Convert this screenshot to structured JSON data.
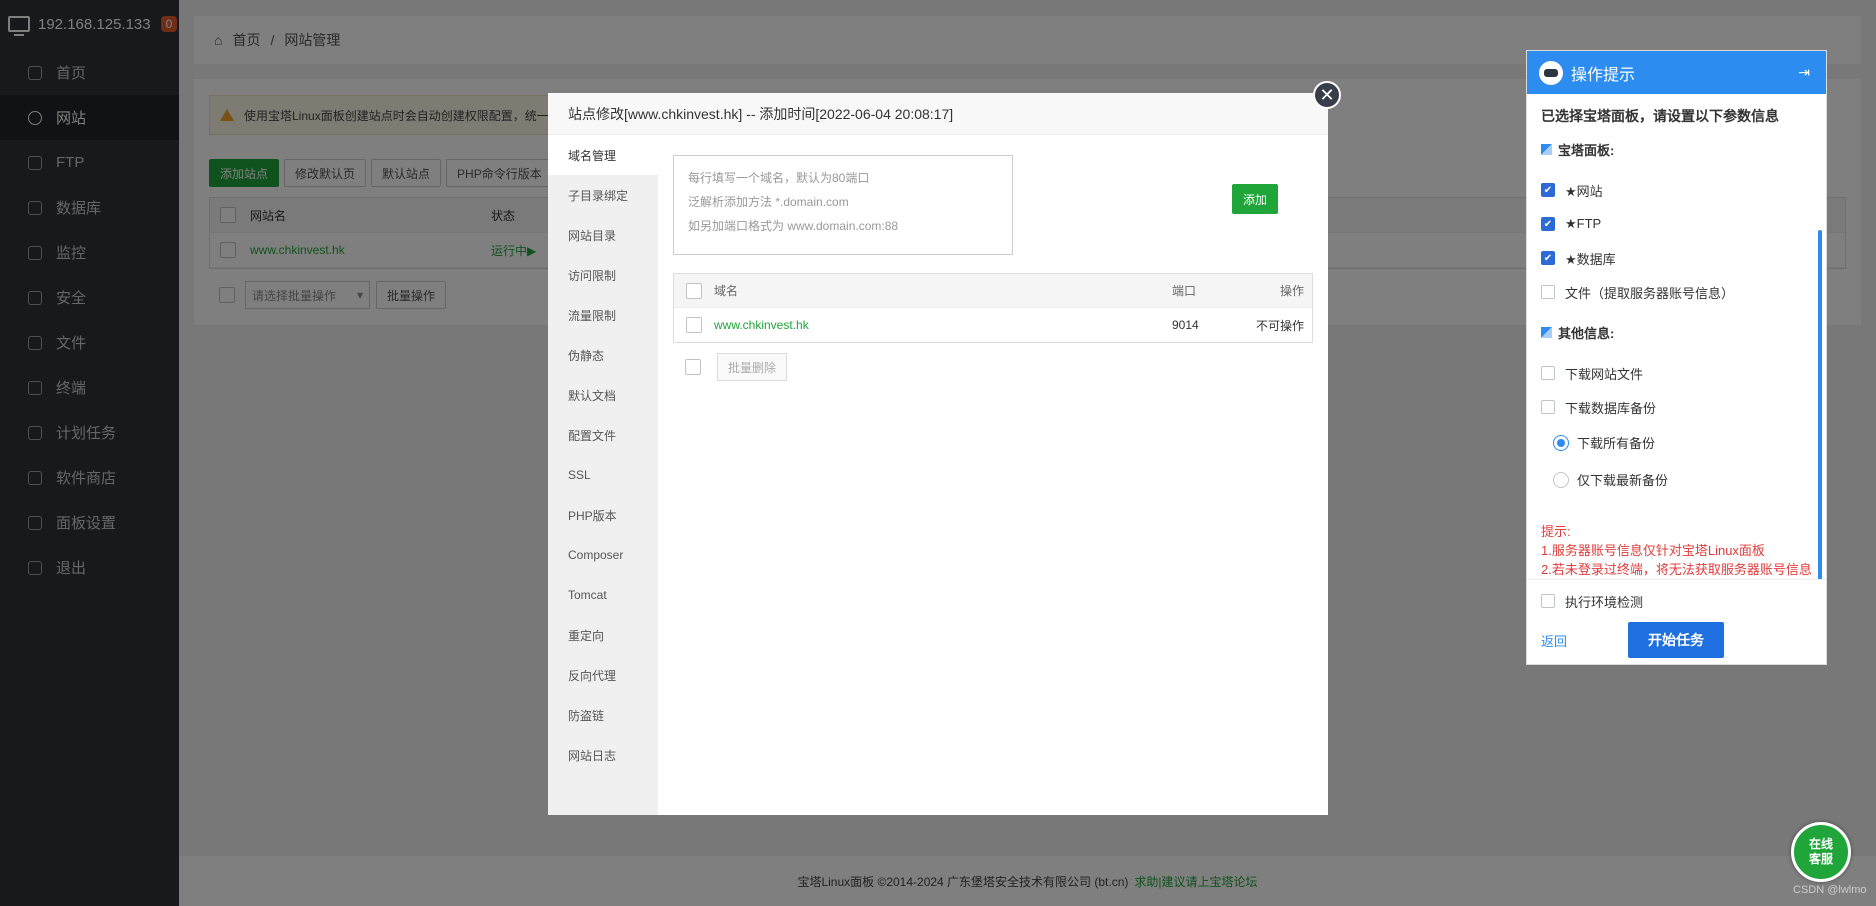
{
  "sidebar": {
    "host": "192.168.125.133",
    "badge": "0",
    "items": [
      {
        "label": "首页",
        "icon": "home-icon"
      },
      {
        "label": "网站",
        "icon": "globe-icon",
        "active": true
      },
      {
        "label": "FTP",
        "icon": "ftp-icon"
      },
      {
        "label": "数据库",
        "icon": "database-icon"
      },
      {
        "label": "监控",
        "icon": "monitor-icon"
      },
      {
        "label": "安全",
        "icon": "shield-icon"
      },
      {
        "label": "文件",
        "icon": "folder-icon"
      },
      {
        "label": "终端",
        "icon": "terminal-icon"
      },
      {
        "label": "计划任务",
        "icon": "calendar-icon"
      },
      {
        "label": "软件商店",
        "icon": "grid-icon"
      },
      {
        "label": "面板设置",
        "icon": "settings-icon"
      },
      {
        "label": "退出",
        "icon": "logout-icon"
      }
    ]
  },
  "breadcrumb": {
    "home": "首页",
    "sep": "/",
    "current": "网站管理"
  },
  "page": {
    "alert": "使用宝塔Linux面板创建站点时会自动创建权限配置，统一",
    "toolbar": [
      "添加站点",
      "修改默认页",
      "默认站点",
      "PHP命令行版本"
    ],
    "table_headers": [
      "网站名",
      "状态"
    ],
    "rows": [
      {
        "name": "www.chkinvest.hk",
        "status": "运行中▶"
      }
    ],
    "bulk_select": "请选择批量操作",
    "bulk_btn": "批量操作"
  },
  "footer": {
    "text": "宝塔Linux面板 ©2014-2024 广东堡塔安全技术有限公司 (bt.cn)",
    "link": "求助|建议请上宝塔论坛"
  },
  "modal": {
    "title": "站点修改[www.chkinvest.hk] -- 添加时间[2022-06-04 20:08:17]",
    "nav": [
      "域名管理",
      "子目录绑定",
      "网站目录",
      "访问限制",
      "流量限制",
      "伪静态",
      "默认文档",
      "配置文件",
      "SSL",
      "PHP版本",
      "Composer",
      "Tomcat",
      "重定向",
      "反向代理",
      "防盗链",
      "网站日志"
    ],
    "placeholder_lines": [
      "每行填写一个域名，默认为80端口",
      "泛解析添加方法 *.domain.com",
      "如另加端口格式为 www.domain.com:88"
    ],
    "add_label": "添加",
    "headers": {
      "name": "域名",
      "port": "端口",
      "op": "操作"
    },
    "domains": [
      {
        "name": "www.chkinvest.hk",
        "port": "9014",
        "op": "不可操作"
      }
    ],
    "bulk_delete": "批量删除"
  },
  "panel": {
    "title": "操作提示",
    "collapse": "⇥",
    "intro": "已选择宝塔面板，请设置以下参数信息",
    "section1": "宝塔面板:",
    "options1": [
      {
        "label": "★网站",
        "checked": true
      },
      {
        "label": "★FTP",
        "checked": true
      },
      {
        "label": "★数据库",
        "checked": true
      },
      {
        "label": "文件（提取服务器账号信息）",
        "checked": false
      }
    ],
    "section2": "其他信息:",
    "options2": [
      {
        "label": "下载网站文件",
        "checked": false
      },
      {
        "label": "下载数据库备份",
        "checked": false
      }
    ],
    "radios": [
      {
        "label": "下载所有备份",
        "selected": true
      },
      {
        "label": "仅下载最新备份",
        "selected": false
      }
    ],
    "tips": [
      "提示:",
      "1.服务器账号信息仅针对宝塔Linux面板",
      "2.若未登录过终端，将无法获取服务器账号信息"
    ],
    "env_check": "执行环境检测",
    "back": "返回",
    "start": "开始任务"
  },
  "online_service": [
    "在线",
    "客服"
  ],
  "watermark": "CSDN @lwlmo",
  "colors": {
    "sidebar": "#2f333b",
    "accent_green": "#20a53a",
    "panel_blue": "#2d8cf0",
    "tip_red": "#e03c3c"
  }
}
